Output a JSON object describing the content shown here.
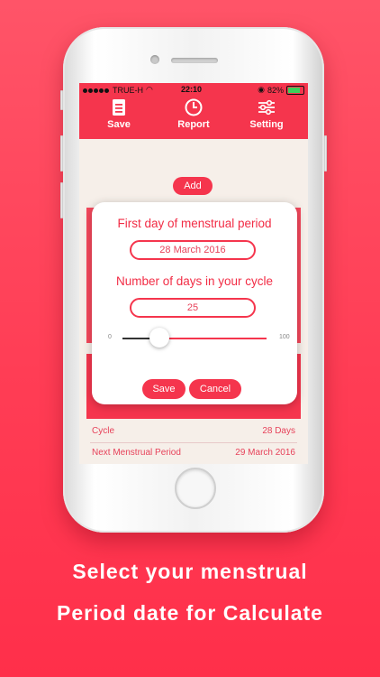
{
  "status_bar": {
    "carrier": "TRUE-H",
    "time": "22:10",
    "battery": "82%"
  },
  "tabs": {
    "save": "Save",
    "report": "Report",
    "setting": "Setting"
  },
  "add_button": "Add",
  "list": [
    {
      "label": "Cycle",
      "value": "28 Days"
    },
    {
      "label": "Next Menstrual Period",
      "value": "29 March 2016"
    }
  ],
  "modal": {
    "first_day_label": "First day of menstrual period",
    "first_day_value": "28 March 2016",
    "cycle_label": "Number of days in your cycle",
    "cycle_value": "25",
    "slider_min": "0",
    "slider_max": "100",
    "slider_value": 25,
    "save_label": "Save",
    "cancel_label": "Cancel"
  },
  "caption": {
    "line1": "Select your menstrual",
    "line2": "Period date for Calculate"
  },
  "colors": {
    "accent": "#f5354d",
    "background": "#ff4258"
  }
}
